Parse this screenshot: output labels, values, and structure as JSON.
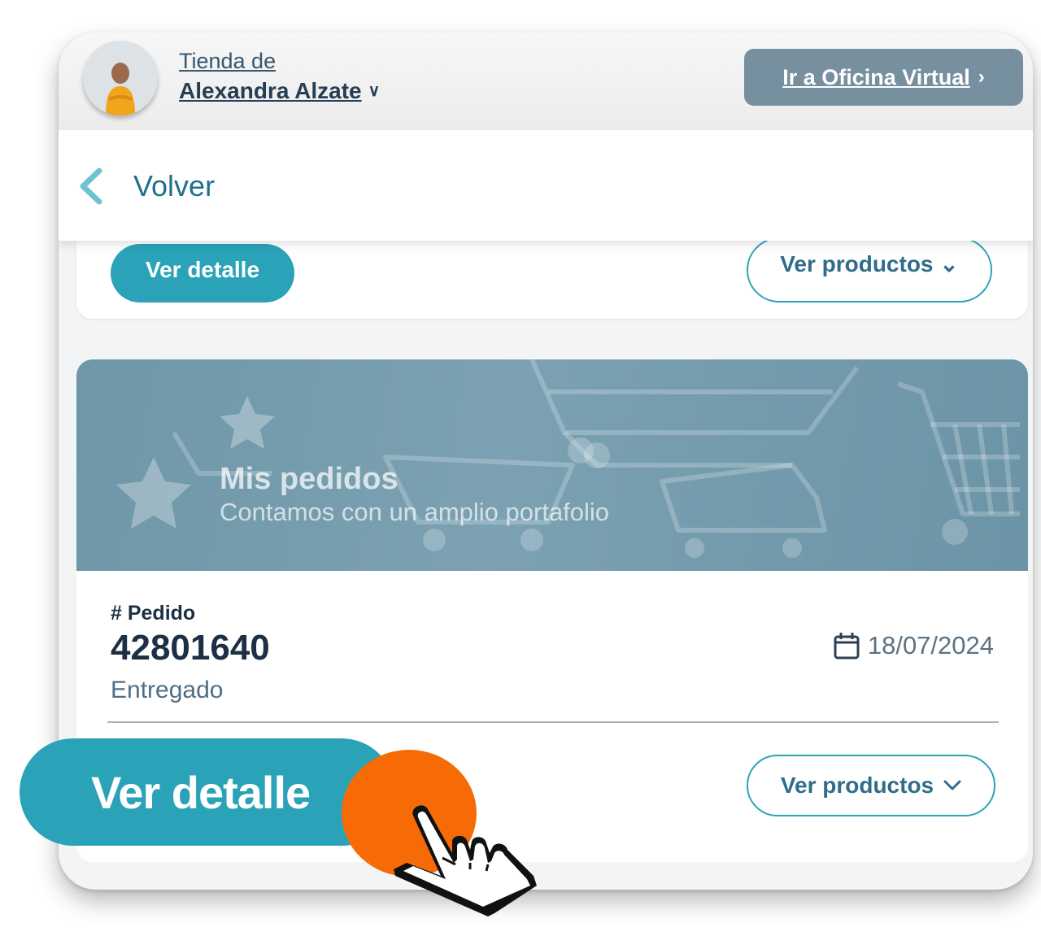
{
  "header": {
    "store_prefix": "Tienda de",
    "store_owner": "Alexandra Alzate",
    "office_button": "Ir a Oficina Virtual",
    "office_chevron": "›"
  },
  "navigation": {
    "back_label": "Volver"
  },
  "previous_order": {
    "detail_button": "Ver detalle",
    "products_button": "Ver productos ⌄"
  },
  "banner": {
    "title": "Mis pedidos",
    "subtitle": "Contamos con un amplio portafolio"
  },
  "order": {
    "number_label": "# Pedido",
    "number": "42801640",
    "status": "Entregado",
    "date": "18/07/2024",
    "products_button": "Ver productos"
  },
  "overlay": {
    "detail_button": "Ver detalle"
  },
  "colors": {
    "accent": "#2aa3b8",
    "click_indicator": "#f76b07",
    "office_button_bg": "#76909f",
    "banner_bg": "#7ba1b2"
  }
}
